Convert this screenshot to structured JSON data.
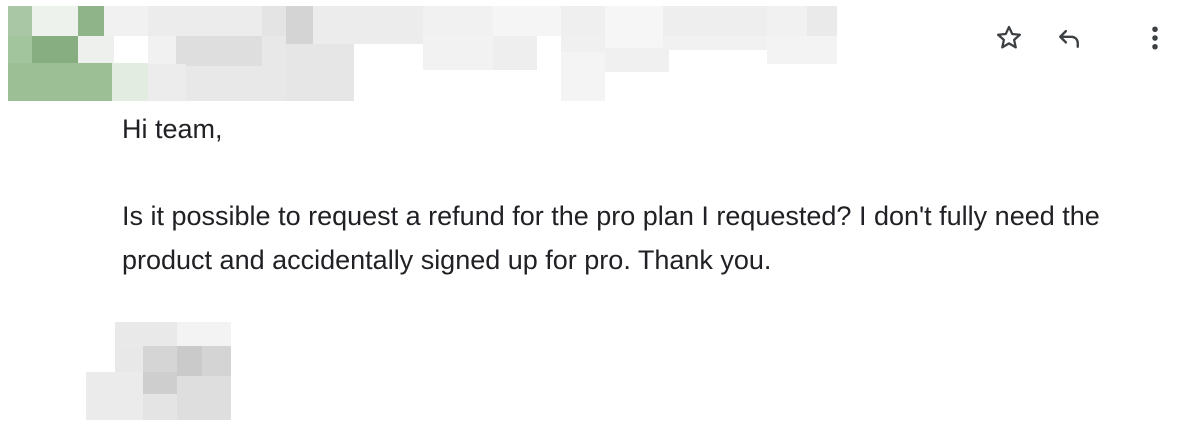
{
  "email": {
    "greeting": "Hi team,",
    "body": "Is it possible to request a refund for the pro plan I requested? I don't fully need the product and accidentally signed up for pro. Thank you."
  },
  "actions": {
    "star_icon": "star-outline-icon",
    "reply_icon": "reply-arrow-icon",
    "more_icon": "more-vertical-icon"
  },
  "colors": {
    "text": "#202124",
    "icon": "#3c4043",
    "avatar_green": "#8fb48a",
    "blur_gray": "#e6e6e6"
  }
}
